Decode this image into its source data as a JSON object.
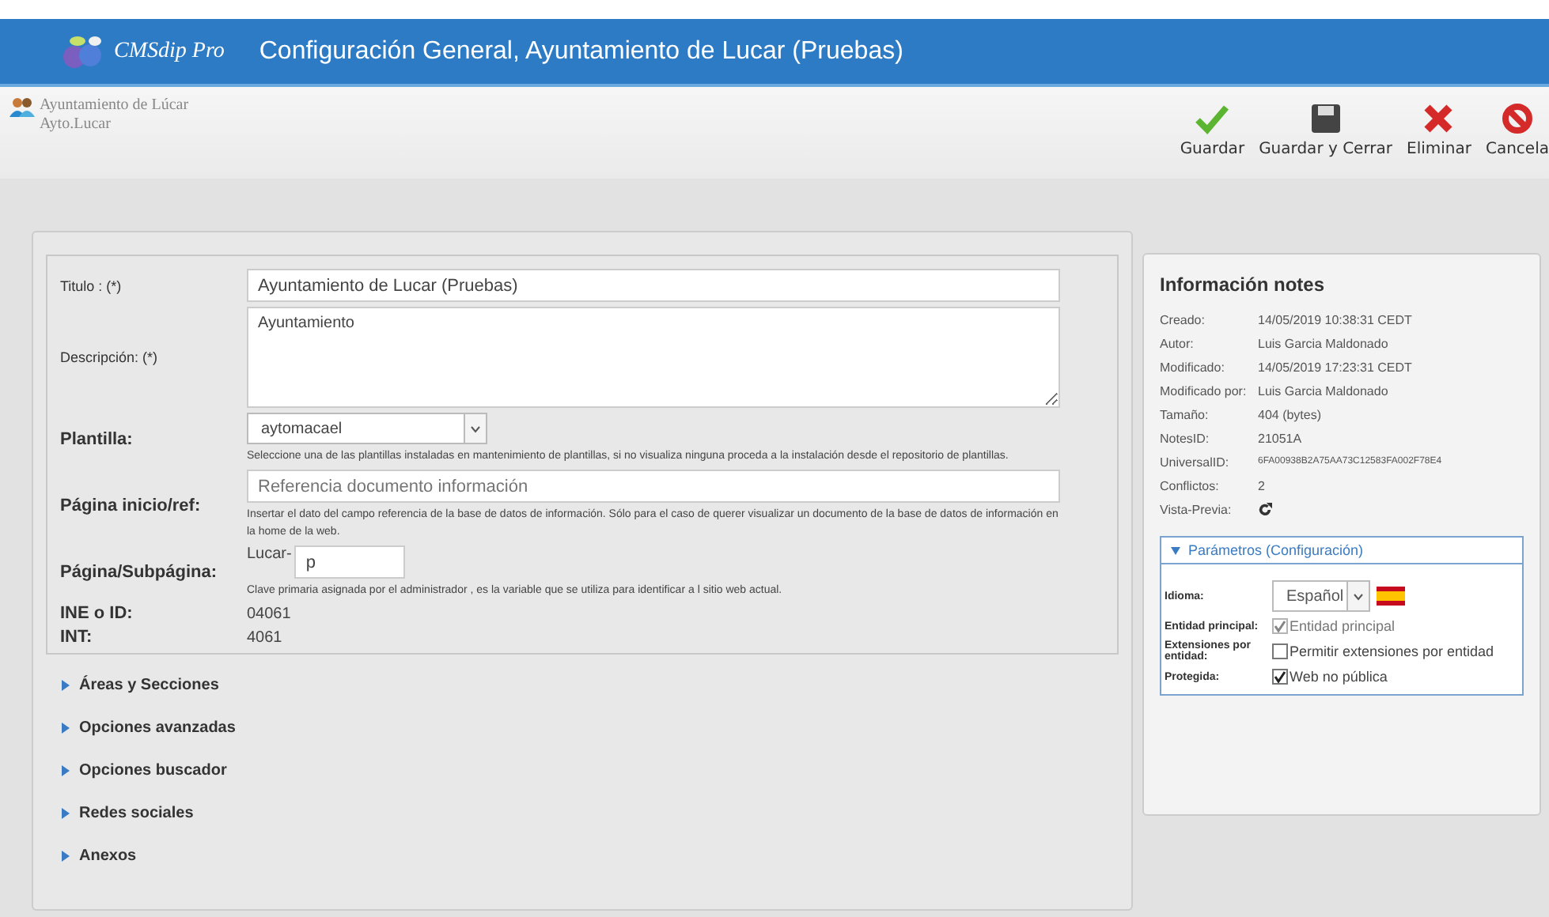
{
  "header": {
    "brand": "CMSdip Pro",
    "title": "Configuración General, Ayuntamiento de Lucar (Pruebas)"
  },
  "user": {
    "name": "Ayuntamiento de Lúcar",
    "account": "Ayto.Lucar"
  },
  "toolbar": [
    {
      "kind": "save",
      "label": "Guardar"
    },
    {
      "kind": "save-close",
      "label": "Guardar y Cerrar"
    },
    {
      "kind": "delete",
      "label": "Eliminar"
    },
    {
      "kind": "cancel",
      "label": "Cancela"
    }
  ],
  "form": {
    "fields": [
      {
        "kind": "input",
        "label": "Titulo : (*)",
        "value": "Ayuntamiento de Lucar (Pruebas)"
      },
      {
        "kind": "textarea",
        "label": "Descripción: (*)",
        "value": "Ayuntamiento"
      },
      {
        "kind": "select",
        "label": "Plantilla:",
        "value": "aytomacael",
        "help": "Seleccione una de las plantillas instaladas en mantenimiento de plantillas, si no visualiza ninguna proceda a la instalación desde el repositorio de plantillas."
      },
      {
        "kind": "input",
        "label": "Página inicio/ref:",
        "placeholder": "Referencia documento información",
        "help": "Insertar el dato del campo referencia de la base de datos de información.  Sólo para el caso de querer visualizar un documento de la base de datos de información en la home de la web."
      },
      {
        "kind": "prefixed",
        "label": "Página/Subpágina:",
        "prefix": "Lucar-",
        "value": "p",
        "help": "Clave primaria asignada por el administrador , es la variable que se utiliza para identificar   a l sitio web actual."
      },
      {
        "kind": "text",
        "label": "INE o ID:",
        "value": "04061"
      },
      {
        "kind": "text",
        "label": "INT:",
        "value": "4061"
      }
    ],
    "sections": [
      {
        "label": "Áreas y Secciones",
        "expanded": false
      },
      {
        "label": "Opciones avanzadas",
        "expanded": false
      },
      {
        "label": "Opciones buscador",
        "expanded": false
      },
      {
        "label": "Redes sociales",
        "expanded": false
      },
      {
        "label": "Anexos",
        "expanded": false
      }
    ]
  },
  "info": {
    "title": "Información notes",
    "rows": [
      {
        "kind": "text",
        "label": "Creado:",
        "value": "14/05/2019 10:38:31 CEDT"
      },
      {
        "kind": "text",
        "label": "Autor:",
        "value": "Luis Garcia Maldonado"
      },
      {
        "kind": "text",
        "label": "Modificado:",
        "value": "14/05/2019 17:23:31 CEDT"
      },
      {
        "kind": "text",
        "label": "Modificado por:",
        "value": "Luis Garcia Maldonado"
      },
      {
        "kind": "text",
        "label": "Tamaño:",
        "value": "404 (bytes)"
      },
      {
        "kind": "text",
        "label": "NotesID:",
        "value": "21051A"
      },
      {
        "kind": "id",
        "label": "UniversalID:",
        "value": "6FA00938B2A75AA73C12583FA002F78E4"
      },
      {
        "kind": "text",
        "label": "Conflictos:",
        "value": "2"
      },
      {
        "kind": "preview",
        "label": "Vista-Previa:"
      }
    ],
    "params": {
      "title": "Parámetros (Configuración)",
      "expanded": true,
      "language": {
        "label": "Idioma:",
        "value": "Español"
      },
      "options": [
        {
          "label": "Entidad principal:",
          "text": "Entidad principal",
          "checked": true,
          "disabled": true
        },
        {
          "label": "Extensiones por entidad:",
          "text": "Permitir extensiones por entidad",
          "checked": false,
          "disabled": false
        },
        {
          "label": "Protegida:",
          "text": "Web no pública",
          "checked": true,
          "disabled": false
        }
      ]
    }
  }
}
